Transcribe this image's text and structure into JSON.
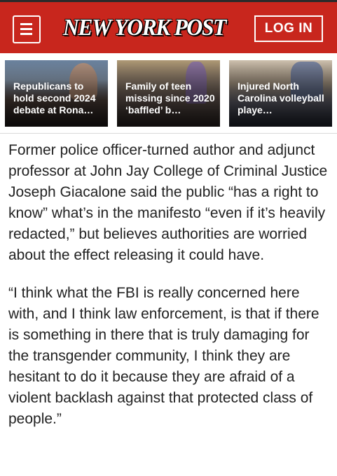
{
  "header": {
    "logo_text": "NEW YORK POST",
    "login_label": "LOG IN",
    "menu_icon": "hamburger-menu-icon",
    "brand_color": "#c8261d"
  },
  "stories": [
    {
      "caption": "Republicans to hold second 2024 debate at Rona…"
    },
    {
      "caption": "Family of teen missing since 2020 ‘baffled’ b…"
    },
    {
      "caption": "Injured North Carolina volleyball playe…"
    }
  ],
  "article": {
    "paragraphs": [
      "Former police officer-turned author and adjunct professor at John Jay College of Criminal Justice Joseph Giacalone said the public “has a right to know” what’s in the manifesto “even if it’s heavily redacted,” but believes authorities are worried about the effect releasing it could have.",
      "“I think what the FBI is really concerned here with, and I think law enforcement, is that if there is something in there that is truly damaging for the transgender community, I think they are hesitant to do it because they are afraid of a violent backlash against that protected class of people.”"
    ]
  }
}
